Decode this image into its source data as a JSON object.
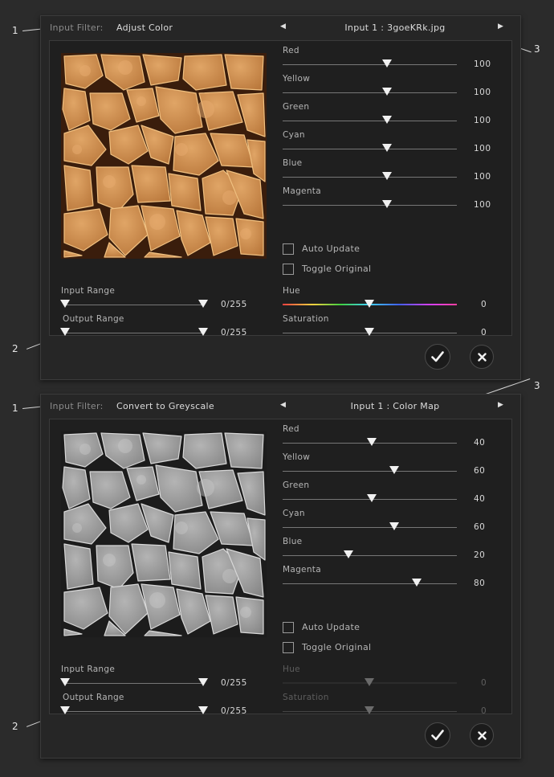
{
  "callouts": {
    "n1": "1",
    "n2": "2",
    "n3": "3"
  },
  "dialogs": [
    {
      "filter_caption": "Input Filter:",
      "filter_name": "Adjust Color",
      "prev_icon": "triangle-left",
      "next_icon": "triangle-right",
      "input_label": "Input 1 : 3goeKRk.jpg",
      "preview_mode": "color",
      "color_sliders": [
        {
          "label": "Red",
          "value": "100"
        },
        {
          "label": "Yellow",
          "value": "100"
        },
        {
          "label": "Green",
          "value": "100"
        },
        {
          "label": "Cyan",
          "value": "100"
        },
        {
          "label": "Blue",
          "value": "100"
        },
        {
          "label": "Magenta",
          "value": "100"
        }
      ],
      "auto_update": "Auto Update",
      "toggle_original": "Toggle Original",
      "hue": {
        "label": "Hue",
        "value": "0"
      },
      "saturation": {
        "label": "Saturation",
        "value": "0"
      },
      "hue_sat_enabled": true,
      "input_range": {
        "label": "Input Range",
        "value": "0/255"
      },
      "output_range": {
        "label": "Output Range",
        "value": "0/255"
      }
    },
    {
      "filter_caption": "Input Filter:",
      "filter_name": "Convert to Greyscale",
      "prev_icon": "triangle-left",
      "next_icon": "triangle-right",
      "input_label": "Input 1 : Color Map",
      "preview_mode": "greyscale",
      "color_sliders": [
        {
          "label": "Red",
          "value": "40"
        },
        {
          "label": "Yellow",
          "value": "60"
        },
        {
          "label": "Green",
          "value": "40"
        },
        {
          "label": "Cyan",
          "value": "60"
        },
        {
          "label": "Blue",
          "value": "20"
        },
        {
          "label": "Magenta",
          "value": "80"
        }
      ],
      "auto_update": "Auto Update",
      "toggle_original": "Toggle Original",
      "hue": {
        "label": "Hue",
        "value": "0"
      },
      "saturation": {
        "label": "Saturation",
        "value": "0"
      },
      "hue_sat_enabled": false,
      "input_range": {
        "label": "Input Range",
        "value": "0/255"
      },
      "output_range": {
        "label": "Output Range",
        "value": "0/255"
      }
    }
  ]
}
